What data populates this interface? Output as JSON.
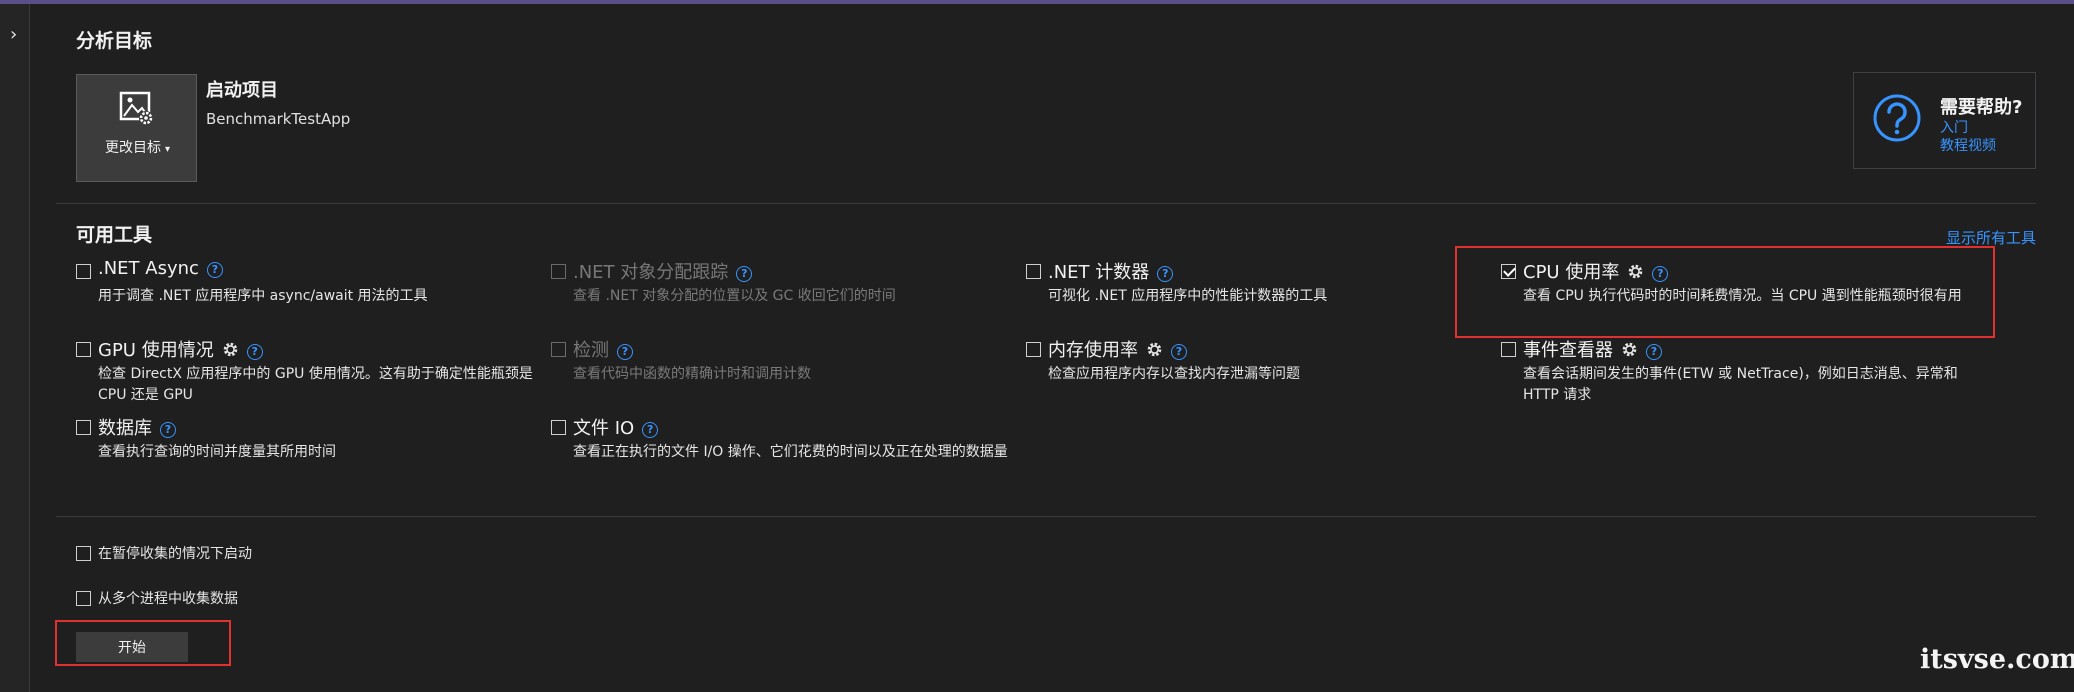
{
  "sidebar": {
    "expand_glyph": "›"
  },
  "target": {
    "section_title": "分析目标",
    "change_target_label": "更改目标",
    "change_target_caret": "▾",
    "startup_title": "启动项目",
    "startup_project": "BenchmarkTestApp",
    "icon": "target-image-gear-icon"
  },
  "help": {
    "title": "需要帮助?",
    "links": [
      "入门",
      "教程视频"
    ],
    "icon": "question-circle-icon"
  },
  "tools": {
    "section_title": "可用工具",
    "show_all": "显示所有工具",
    "items": [
      {
        "name": ".NET Async",
        "desc": "用于调查 .NET 应用程序中 async/await 用法的工具",
        "checked": false,
        "disabled": false,
        "gear": false
      },
      {
        "name": ".NET 对象分配跟踪",
        "desc": "查看 .NET 对象分配的位置以及 GC 收回它们的时间",
        "checked": false,
        "disabled": true,
        "gear": false
      },
      {
        "name": ".NET 计数器",
        "desc": "可视化 .NET 应用程序中的性能计数器的工具",
        "checked": false,
        "disabled": false,
        "gear": false
      },
      {
        "name": "CPU 使用率",
        "desc": "查看 CPU 执行代码时的时间耗费情况。当 CPU 遇到性能瓶颈时很有用",
        "checked": true,
        "disabled": false,
        "gear": true
      },
      {
        "name": "GPU 使用情况",
        "desc": "检查 DirectX 应用程序中的 GPU 使用情况。这有助于确定性能瓶颈是 CPU 还是 GPU",
        "checked": false,
        "disabled": false,
        "gear": true
      },
      {
        "name": "检测",
        "desc": "查看代码中函数的精确计时和调用计数",
        "checked": false,
        "disabled": true,
        "gear": false
      },
      {
        "name": "内存使用率",
        "desc": "检查应用程序内存以查找内存泄漏等问题",
        "checked": false,
        "disabled": false,
        "gear": true
      },
      {
        "name": "事件查看器",
        "desc": "查看会话期间发生的事件(ETW 或 NetTrace)，例如日志消息、异常和 HTTP 请求",
        "checked": false,
        "disabled": false,
        "gear": true
      },
      {
        "name": "数据库",
        "desc": "查看执行查询的时间并度量其所用时间",
        "checked": false,
        "disabled": false,
        "gear": false
      },
      {
        "name": "文件 IO",
        "desc": "查看正在执行的文件 I/O 操作、它们花费的时间以及正在处理的数据量",
        "checked": false,
        "disabled": false,
        "gear": false
      }
    ]
  },
  "options": {
    "start_paused": "在暂停收集的情况下启动",
    "multi_process": "从多个进程中收集数据"
  },
  "start_button": "开始",
  "help_glyph": "?",
  "watermark": "itsvse.com",
  "colors": {
    "accent": "#3794ff",
    "highlight": "#e03131",
    "background": "#1f1f1f"
  }
}
